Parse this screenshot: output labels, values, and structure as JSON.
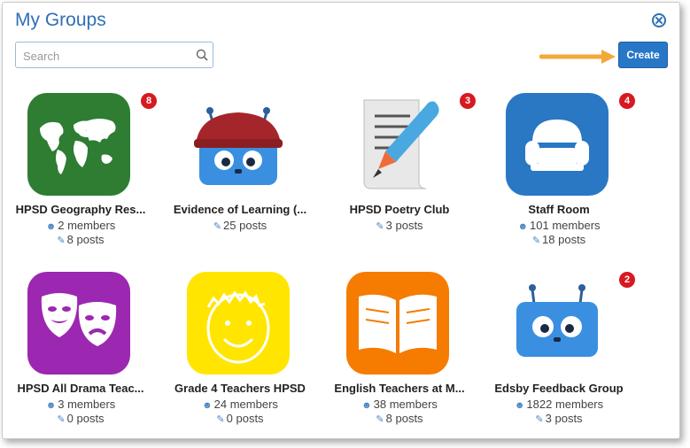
{
  "header": {
    "title": "My Groups"
  },
  "search": {
    "placeholder": "Search"
  },
  "toolbar": {
    "create_label": "Create"
  },
  "colors": {
    "accent": "#2f6fb5",
    "badge": "#d71920",
    "arrow": "#f2a93b"
  },
  "groups": [
    {
      "name": "HPSD Geography Res...",
      "members": "2 members",
      "posts": "8 posts",
      "badge": "8",
      "icon": "world-map-icon",
      "color": "#2e7d32"
    },
    {
      "name": "Evidence of Learning (...",
      "members": "",
      "posts": "25 posts",
      "badge": "",
      "icon": "robot-toque-icon",
      "color": "#ffffff"
    },
    {
      "name": "HPSD Poetry Club",
      "members": "",
      "posts": "3 posts",
      "badge": "3",
      "icon": "quill-scroll-icon",
      "color": "#ffffff"
    },
    {
      "name": "Staff Room",
      "members": "101 members",
      "posts": "18 posts",
      "badge": "4",
      "icon": "armchair-icon",
      "color": "#2a77c4"
    },
    {
      "name": "HPSD All Drama Teac...",
      "members": "3 members",
      "posts": "0 posts",
      "badge": "",
      "icon": "drama-masks-icon",
      "color": "#9c27b0"
    },
    {
      "name": "Grade 4 Teachers HPSD",
      "members": "24 members",
      "posts": "0 posts",
      "badge": "",
      "icon": "smiley-face-icon",
      "color": "#ffe500"
    },
    {
      "name": "English Teachers at M...",
      "members": "38 members",
      "posts": "8 posts",
      "badge": "",
      "icon": "open-book-icon",
      "color": "#f57c00"
    },
    {
      "name": "Edsby Feedback Group",
      "members": "1822 members",
      "posts": "3 posts",
      "badge": "2",
      "icon": "robot-icon",
      "color": "#ffffff"
    }
  ]
}
